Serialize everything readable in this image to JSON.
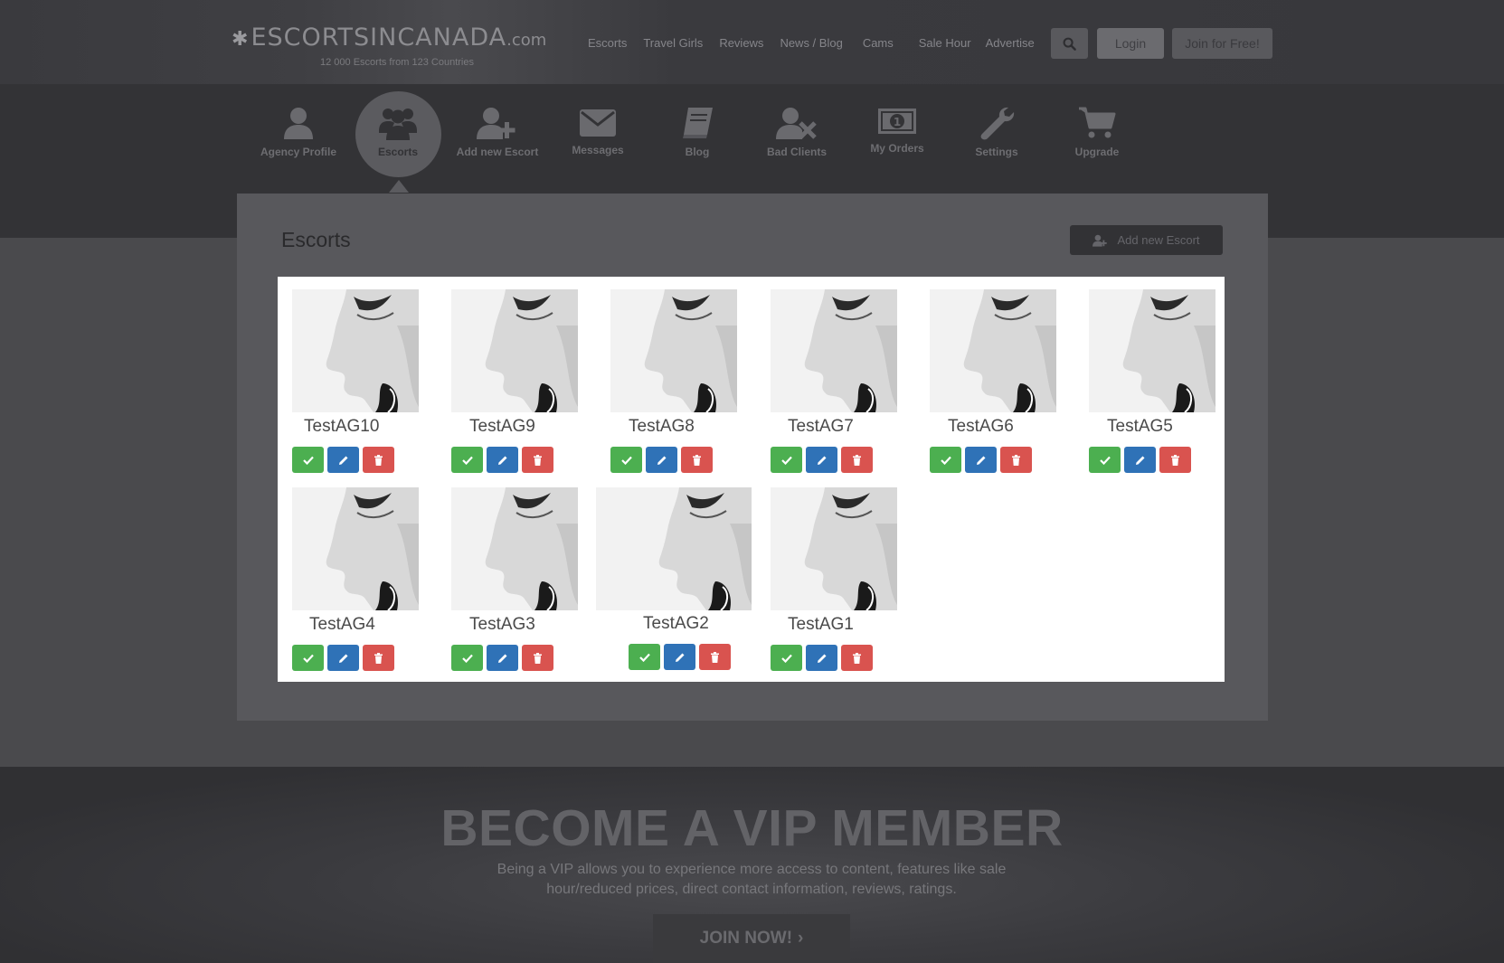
{
  "header": {
    "logo_main": "ESCORTSINCANADA",
    "logo_dotcom": ".com",
    "logo_sub": "12 000 Escorts from 123 Countries",
    "nav": [
      "Escorts",
      "Travel Girls",
      "Reviews",
      "News / Blog",
      "Cams",
      "Sale Hour",
      "Advertise"
    ],
    "login_label": "Login",
    "join_label": "Join for Free!"
  },
  "dashboard": {
    "items": [
      {
        "label": "Agency Profile",
        "icon": "user-icon"
      },
      {
        "label": "Escorts",
        "icon": "users-icon",
        "active": true
      },
      {
        "label": "Add new Escort",
        "icon": "user-plus-icon"
      },
      {
        "label": "Messages",
        "icon": "envelope-icon"
      },
      {
        "label": "Blog",
        "icon": "book-icon"
      },
      {
        "label": "Bad Clients",
        "icon": "user-times-icon"
      },
      {
        "label": "My Orders",
        "icon": "money-icon"
      },
      {
        "label": "Settings",
        "icon": "wrench-icon"
      },
      {
        "label": "Upgrade",
        "icon": "cart-icon"
      }
    ]
  },
  "main": {
    "title": "Escorts",
    "add_button_label": "Add new Escort",
    "escorts": [
      {
        "name": "TestAG10"
      },
      {
        "name": "TestAG9"
      },
      {
        "name": "TestAG8"
      },
      {
        "name": "TestAG7"
      },
      {
        "name": "TestAG6"
      },
      {
        "name": "TestAG5"
      },
      {
        "name": "TestAG4"
      },
      {
        "name": "TestAG3"
      },
      {
        "name": "TestAG2"
      },
      {
        "name": "TestAG1"
      }
    ]
  },
  "footer": {
    "vip_title": "BECOME A VIP MEMBER",
    "vip_text": "Being a VIP allows you to experience more access to content, features like sale hour/reduced prices, direct contact information, reviews, ratings.",
    "join_now_label": "JOIN NOW!"
  },
  "colors": {
    "approve": "#4caf50",
    "edit": "#2f72b7",
    "delete": "#d9534f"
  }
}
